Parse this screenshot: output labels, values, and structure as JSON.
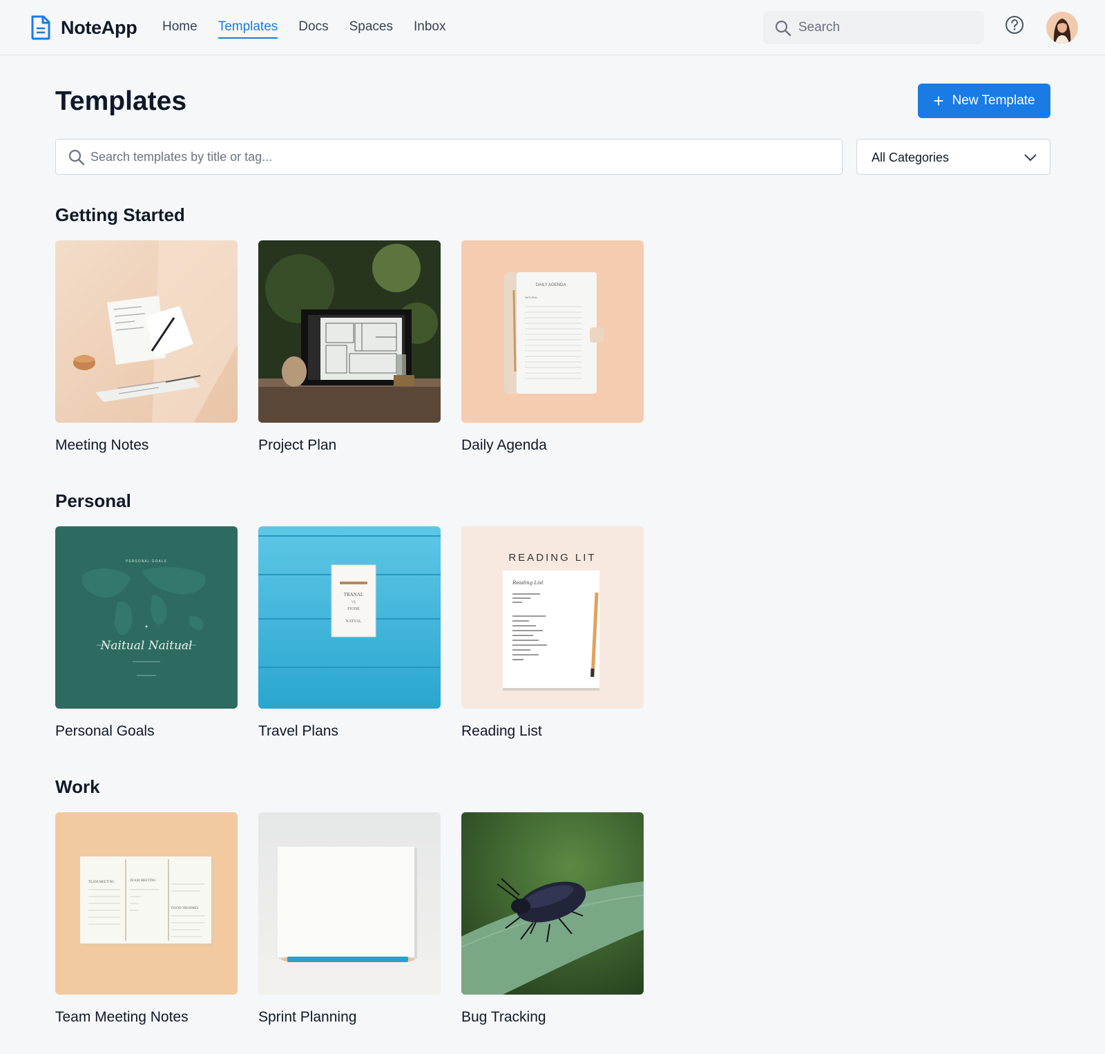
{
  "app": {
    "name": "NoteApp",
    "accent": "#1a7be5"
  },
  "nav": {
    "items": [
      {
        "label": "Home",
        "active": false
      },
      {
        "label": "Templates",
        "active": true
      },
      {
        "label": "Docs",
        "active": false
      },
      {
        "label": "Spaces",
        "active": false
      },
      {
        "label": "Inbox",
        "active": false
      }
    ],
    "search_placeholder": "Search",
    "help_icon": "help-circle-icon",
    "avatar_icon": "user-avatar"
  },
  "page": {
    "title": "Templates",
    "new_button": "New Template",
    "search_placeholder": "Search templates by title or tag...",
    "category_value": "All Categories"
  },
  "sections": [
    {
      "title": "Getting Started",
      "cards": [
        {
          "label": "Meeting Notes"
        },
        {
          "label": "Project Plan"
        },
        {
          "label": "Daily Agenda",
          "image_text": [
            "DAILY AGENDA",
            "NATURAL"
          ]
        }
      ]
    },
    {
      "title": "Personal",
      "cards": [
        {
          "label": "Personal Goals",
          "image_text": [
            "PERSONAL GOALS",
            "Naitual Naitual"
          ]
        },
        {
          "label": "Travel Plans",
          "image_text": [
            "TRANAL",
            "VE",
            "FIONE",
            "NATVAL"
          ]
        },
        {
          "label": "Reading List",
          "image_text": [
            "READING LIT",
            "Reading List"
          ]
        }
      ]
    },
    {
      "title": "Work",
      "cards": [
        {
          "label": "Team Meeting Notes",
          "image_text": [
            "TEAM MEETING",
            "TEAM MEETING",
            "DOOD TROOMES"
          ]
        },
        {
          "label": "Sprint Planning"
        },
        {
          "label": "Bug Tracking"
        }
      ]
    }
  ]
}
